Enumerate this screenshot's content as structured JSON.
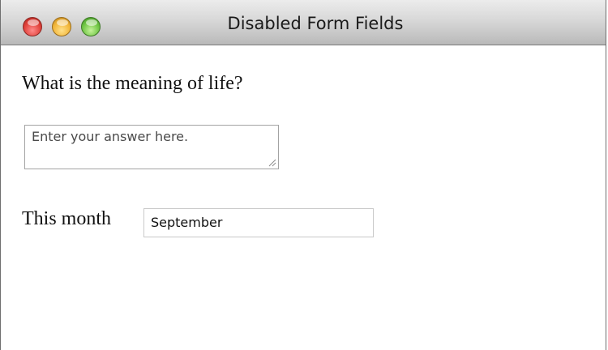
{
  "window": {
    "title": "Disabled Form Fields"
  },
  "form": {
    "question_label": "What is the meaning of life?",
    "answer_placeholder": "Enter your answer here.",
    "month_label": "This month",
    "month_value": "September"
  },
  "colors": {
    "close": "#e0413a",
    "minimize": "#f2b63a",
    "zoom": "#6fc544"
  }
}
